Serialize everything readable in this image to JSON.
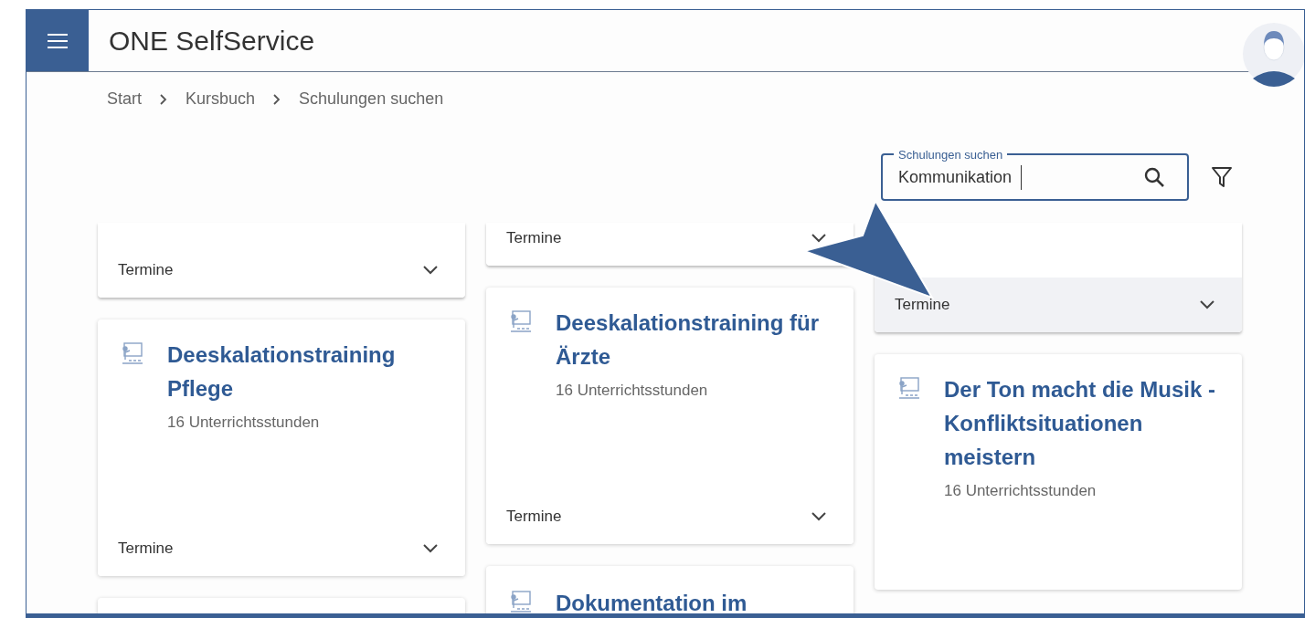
{
  "header": {
    "title": "ONE SelfService"
  },
  "breadcrumb": [
    "Start",
    "Kursbuch",
    "Schulungen suchen"
  ],
  "search": {
    "label": "Schulungen suchen",
    "value": "Kommunikation"
  },
  "columns": [
    {
      "cards": [
        {
          "kind": "partial",
          "footer": "Termine",
          "highlighted": false
        },
        {
          "kind": "full",
          "title": "Deeskalationstraining Pflege",
          "hours": "16 Unterrichtsstunden",
          "footer": "Termine",
          "highlighted": false
        },
        {
          "kind": "stub"
        }
      ]
    },
    {
      "cards": [
        {
          "kind": "partial",
          "footer": "Termine",
          "highlighted": false
        },
        {
          "kind": "full",
          "title": "Deeskalationstraining für Ärzte",
          "hours": "16 Unterrichtsstunden",
          "footer": "Termine",
          "highlighted": false
        },
        {
          "kind": "stub",
          "title": "Dokumentation im"
        }
      ]
    },
    {
      "cards": [
        {
          "kind": "partial",
          "footer": "Termine",
          "highlighted": true
        },
        {
          "kind": "full",
          "title": "Der Ton macht die Musik - Konfliktsituationen meistern",
          "hours": "16 Unterrichtsstunden"
        }
      ]
    }
  ]
}
